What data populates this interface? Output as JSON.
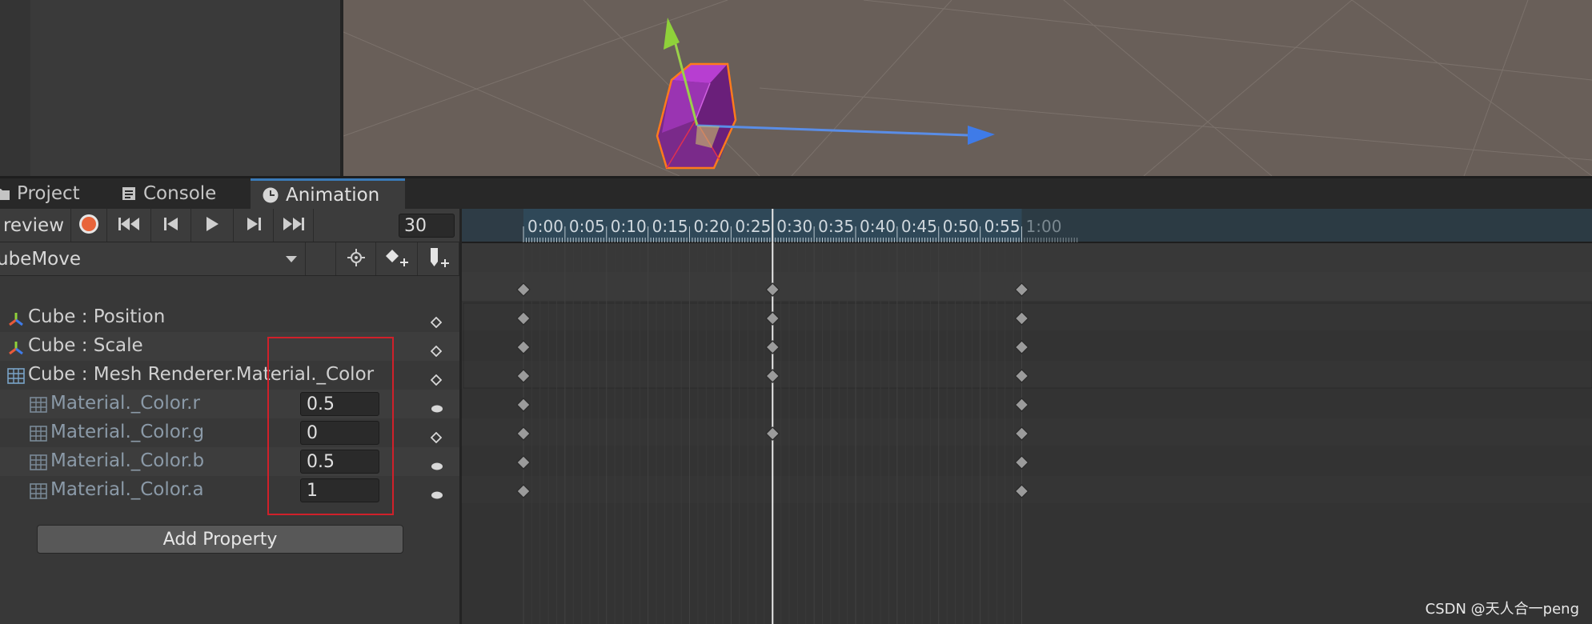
{
  "tabs": [
    {
      "id": "project",
      "label": "Project",
      "icon": "folder-icon"
    },
    {
      "id": "console",
      "label": "Console",
      "icon": "console-icon"
    },
    {
      "id": "animation",
      "label": "Animation",
      "icon": "clock-icon",
      "active": true
    }
  ],
  "controls": {
    "preview_label": "review",
    "frame": "30"
  },
  "clip": {
    "name": "ubeMove"
  },
  "properties": [
    {
      "label": "Cube : Position",
      "icon": "transform-icon",
      "level": 0,
      "value": null
    },
    {
      "label": "Cube : Scale",
      "icon": "transform-icon",
      "level": 0,
      "value": null
    },
    {
      "label": "Cube : Mesh Renderer.Material._Color",
      "icon": "mesh-renderer-icon",
      "level": 0,
      "value": null
    },
    {
      "label": "Material._Color.r",
      "icon": "mesh-renderer-icon",
      "level": 1,
      "value": "0.5"
    },
    {
      "label": "Material._Color.g",
      "icon": "mesh-renderer-icon",
      "level": 1,
      "value": "0"
    },
    {
      "label": "Material._Color.b",
      "icon": "mesh-renderer-icon",
      "level": 1,
      "value": "0.5"
    },
    {
      "label": "Material._Color.a",
      "icon": "mesh-renderer-icon",
      "level": 1,
      "value": "1"
    }
  ],
  "add_property_label": "Add Property",
  "timeline": {
    "time_labels": [
      "0:00",
      "0:05",
      "0:10",
      "0:15",
      "0:20",
      "0:25",
      "0:30",
      "0:35",
      "0:40",
      "0:45",
      "0:50",
      "0:55",
      "1:00"
    ],
    "playhead_time": "0:30",
    "keyframe_times": {
      "summary": [
        "0:00",
        "0:30",
        "1:00"
      ],
      "Cube : Position": [
        "0:00",
        "0:30",
        "1:00"
      ],
      "Cube : Scale": [
        "0:00",
        "0:30",
        "1:00"
      ],
      "Cube : Mesh Renderer.Material._Color": [
        "0:00",
        "0:30",
        "1:00"
      ],
      "Material._Color.r": [
        "0:00",
        "1:00"
      ],
      "Material._Color.g": [
        "0:00",
        "0:30",
        "1:00"
      ],
      "Material._Color.b": [
        "0:00",
        "1:00"
      ],
      "Material._Color.a": [
        "0:00",
        "1:00"
      ]
    }
  },
  "watermark": "CSDN @天人合一peng",
  "colors": {
    "record": "#e8643a",
    "ruler_bg": "#2f4858",
    "highlight": "#d0202a",
    "cube": "#b73ed1",
    "cube_outline": "#ff7a1c"
  }
}
